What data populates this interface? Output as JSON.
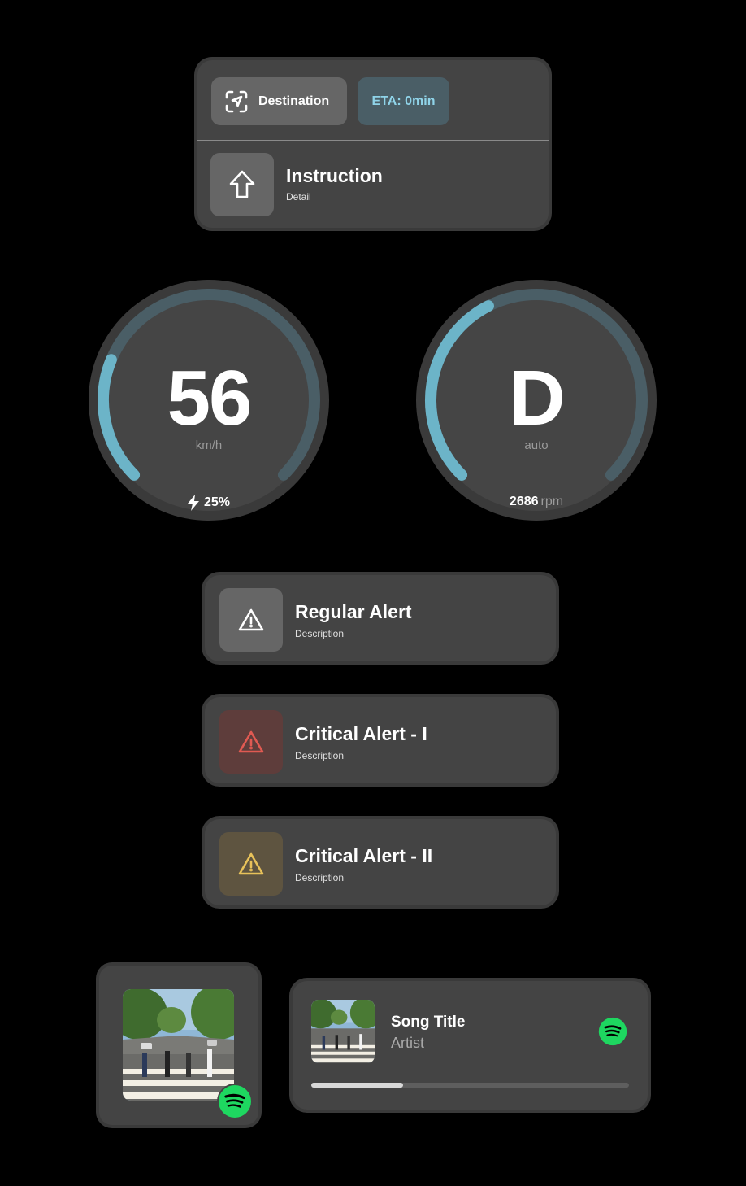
{
  "navigation": {
    "destination_label": "Destination",
    "eta_label": "ETA: 0min",
    "instruction_title": "Instruction",
    "instruction_detail": "Detail",
    "destination_icon": "target-navigation-icon",
    "instruction_icon": "arrow-up-icon",
    "eta_color": "#8fd3e8"
  },
  "speed_gauge": {
    "value": "56",
    "unit": "km/h",
    "battery_label": "25%",
    "battery_icon": "bolt-icon",
    "arc_fill_fraction": 0.25,
    "arc_color": "#6cb4c8"
  },
  "gear_gauge": {
    "value": "D",
    "mode": "auto",
    "rpm_value": "2686",
    "rpm_unit": "rpm",
    "arc_fill_fraction": 0.4,
    "arc_color": "#6cb4c8"
  },
  "alerts": [
    {
      "title": "Regular Alert",
      "description": "Description",
      "icon": "warning-triangle-icon",
      "color": "#ffffff"
    },
    {
      "title": "Critical Alert - I",
      "description": "Description",
      "icon": "warning-triangle-icon",
      "color": "#e05a52"
    },
    {
      "title": "Critical Alert - II",
      "description": "Description",
      "icon": "warning-triangle-icon",
      "color": "#e8c25a"
    }
  ],
  "media": {
    "song_title": "Song Title",
    "artist": "Artist",
    "progress_fraction": 0.29,
    "service_icon": "spotify-icon",
    "service_color": "#1ed760"
  }
}
